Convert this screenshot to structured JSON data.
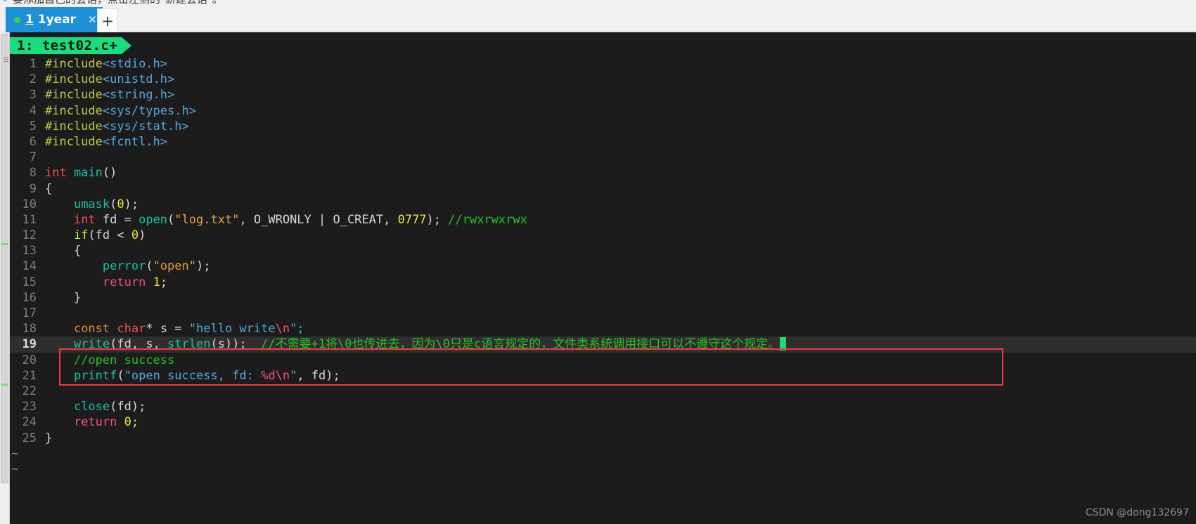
{
  "window": {
    "partial_top_text": "要添加自己的会话，点击左侧的\"新建会话\"。",
    "arrow_glyph": "➜"
  },
  "tabbar": {
    "tabs": [
      {
        "number": "1",
        "label": "1year",
        "status": "connected",
        "close_glyph": "✕"
      }
    ],
    "new_tab_glyph": "+"
  },
  "editor": {
    "filename_banner": "1: test02.c+",
    "tilde_rows": [
      "~",
      "~"
    ],
    "current_line": 19,
    "lines": [
      {
        "n": "1",
        "tokens": [
          {
            "t": "#include",
            "c": "c-pre"
          },
          {
            "t": "<stdio.h>",
            "c": "c-hdr"
          }
        ]
      },
      {
        "n": "2",
        "tokens": [
          {
            "t": "#include",
            "c": "c-pre"
          },
          {
            "t": "<unistd.h>",
            "c": "c-hdr"
          }
        ]
      },
      {
        "n": "3",
        "tokens": [
          {
            "t": "#include",
            "c": "c-pre"
          },
          {
            "t": "<string.h>",
            "c": "c-hdr"
          }
        ]
      },
      {
        "n": "4",
        "tokens": [
          {
            "t": "#include",
            "c": "c-pre"
          },
          {
            "t": "<sys/types.h>",
            "c": "c-hdr"
          }
        ]
      },
      {
        "n": "5",
        "tokens": [
          {
            "t": "#include",
            "c": "c-pre"
          },
          {
            "t": "<sys/stat.h>",
            "c": "c-hdr"
          }
        ]
      },
      {
        "n": "6",
        "tokens": [
          {
            "t": "#include",
            "c": "c-pre"
          },
          {
            "t": "<fcntl.h>",
            "c": "c-hdr"
          }
        ]
      },
      {
        "n": "7",
        "tokens": []
      },
      {
        "n": "8",
        "tokens": [
          {
            "t": "int",
            "c": "c-type"
          },
          {
            "t": " ",
            "c": "c-id"
          },
          {
            "t": "main",
            "c": "c-func"
          },
          {
            "t": "()",
            "c": "c-punc"
          }
        ]
      },
      {
        "n": "9",
        "tokens": [
          {
            "t": "{",
            "c": "c-punc"
          }
        ]
      },
      {
        "n": "10",
        "tokens": [
          {
            "t": "    ",
            "c": "c-id"
          },
          {
            "t": "umask",
            "c": "c-func"
          },
          {
            "t": "(",
            "c": "c-punc"
          },
          {
            "t": "0",
            "c": "c-num"
          },
          {
            "t": ");",
            "c": "c-punc"
          }
        ]
      },
      {
        "n": "11",
        "tokens": [
          {
            "t": "    ",
            "c": "c-id"
          },
          {
            "t": "int",
            "c": "c-type"
          },
          {
            "t": " fd = ",
            "c": "c-id"
          },
          {
            "t": "open",
            "c": "c-func"
          },
          {
            "t": "(",
            "c": "c-punc"
          },
          {
            "t": "\"log.txt\"",
            "c": "c-str"
          },
          {
            "t": ", O_WRONLY | O_CREAT, ",
            "c": "c-id"
          },
          {
            "t": "0777",
            "c": "c-num"
          },
          {
            "t": "); ",
            "c": "c-punc"
          },
          {
            "t": "//rwxrwxrwx",
            "c": "c-cmt"
          }
        ]
      },
      {
        "n": "12",
        "tokens": [
          {
            "t": "    ",
            "c": "c-id"
          },
          {
            "t": "if",
            "c": "c-kw"
          },
          {
            "t": "(fd < ",
            "c": "c-punc"
          },
          {
            "t": "0",
            "c": "c-num"
          },
          {
            "t": ")",
            "c": "c-punc"
          }
        ]
      },
      {
        "n": "13",
        "tokens": [
          {
            "t": "    {",
            "c": "c-punc"
          }
        ]
      },
      {
        "n": "14",
        "tokens": [
          {
            "t": "        ",
            "c": "c-id"
          },
          {
            "t": "perror",
            "c": "c-func"
          },
          {
            "t": "(",
            "c": "c-punc"
          },
          {
            "t": "\"open\"",
            "c": "c-str"
          },
          {
            "t": ");",
            "c": "c-punc"
          }
        ]
      },
      {
        "n": "15",
        "tokens": [
          {
            "t": "        ",
            "c": "c-id"
          },
          {
            "t": "return",
            "c": "c-ret"
          },
          {
            "t": " ",
            "c": "c-id"
          },
          {
            "t": "1",
            "c": "c-num"
          },
          {
            "t": ";",
            "c": "c-punc"
          }
        ]
      },
      {
        "n": "16",
        "tokens": [
          {
            "t": "    }",
            "c": "c-punc"
          }
        ]
      },
      {
        "n": "17",
        "tokens": []
      },
      {
        "n": "18",
        "tokens": [
          {
            "t": "    ",
            "c": "c-id"
          },
          {
            "t": "const",
            "c": "c-const"
          },
          {
            "t": " ",
            "c": "c-id"
          },
          {
            "t": "char",
            "c": "c-type"
          },
          {
            "t": "* s = ",
            "c": "c-punc"
          },
          {
            "t": "\"hello write",
            "c": "c-str2"
          },
          {
            "t": "\\n",
            "c": "c-esc"
          },
          {
            "t": "\";",
            "c": "c-str2"
          }
        ]
      },
      {
        "n": "19",
        "tokens": [
          {
            "t": "    ",
            "c": "c-id"
          },
          {
            "t": "write",
            "c": "c-func"
          },
          {
            "t": "(fd, s, ",
            "c": "c-punc"
          },
          {
            "t": "strlen",
            "c": "c-func"
          },
          {
            "t": "(s));  ",
            "c": "c-punc"
          },
          {
            "t": "//不需要+1将\\0也传进去，因为\\0只是c语言规定的，文件类系统调用接口可以不遵守这个规定。",
            "c": "c-cmt"
          }
        ],
        "cursor": true
      },
      {
        "n": "20",
        "tokens": [
          {
            "t": "    ",
            "c": "c-id"
          },
          {
            "t": "//open success",
            "c": "c-cmt"
          }
        ]
      },
      {
        "n": "21",
        "tokens": [
          {
            "t": "    ",
            "c": "c-id"
          },
          {
            "t": "printf",
            "c": "c-func"
          },
          {
            "t": "(",
            "c": "c-punc"
          },
          {
            "t": "\"open success, fd: ",
            "c": "c-str2"
          },
          {
            "t": "%d",
            "c": "c-esc"
          },
          {
            "t": "\\n",
            "c": "c-esc"
          },
          {
            "t": "\"",
            "c": "c-str2"
          },
          {
            "t": ", fd);",
            "c": "c-punc"
          }
        ]
      },
      {
        "n": "22",
        "tokens": []
      },
      {
        "n": "23",
        "tokens": [
          {
            "t": "    ",
            "c": "c-id"
          },
          {
            "t": "close",
            "c": "c-func"
          },
          {
            "t": "(fd);",
            "c": "c-punc"
          }
        ]
      },
      {
        "n": "24",
        "tokens": [
          {
            "t": "    ",
            "c": "c-id"
          },
          {
            "t": "return",
            "c": "c-ret"
          },
          {
            "t": " ",
            "c": "c-id"
          },
          {
            "t": "0",
            "c": "c-num"
          },
          {
            "t": ";",
            "c": "c-punc"
          }
        ]
      },
      {
        "n": "25",
        "tokens": [
          {
            "t": "}",
            "c": "c-punc"
          }
        ]
      }
    ]
  },
  "annotation": {
    "type": "red-rectangle",
    "color": "#ef3b3b",
    "covers_lines": "18-19"
  },
  "watermark": {
    "text": "CSDN @dong132697"
  },
  "colors": {
    "tab_active": "#1e90d8",
    "filename_banner": "#17dd7f",
    "terminal_bg": "#1c1c1c",
    "current_line_bg": "#2e2e2e",
    "annotation": "#ef3b3b",
    "cursor": "#17dd7f"
  }
}
